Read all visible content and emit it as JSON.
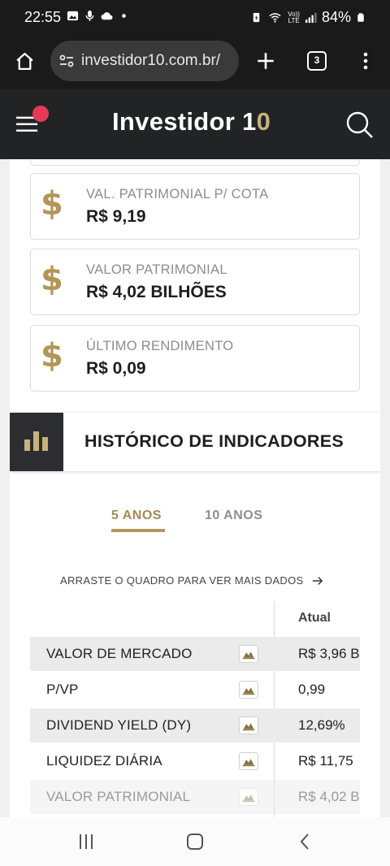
{
  "status_bar": {
    "time": "22:55",
    "battery": "84%",
    "volte_top": "Vo))",
    "volte_bottom": "LTE"
  },
  "browser": {
    "url": "investidor10.com.br/",
    "tab_count": "3"
  },
  "site_header": {
    "logo_main": "Investidor 1",
    "logo_accent": "0"
  },
  "cards": [
    {
      "label": "VAL. PATRIMONIAL P/ COTA",
      "value": "R$ 9,19",
      "icon": "$"
    },
    {
      "label": "VALOR PATRIMONIAL",
      "value": "R$ 4,02 BILHÕES",
      "icon": "$"
    },
    {
      "label": "ÚLTIMO RENDIMENTO",
      "value": "R$ 0,09",
      "icon": "$"
    }
  ],
  "section": {
    "title": "HISTÓRICO DE INDICADORES"
  },
  "tabs": {
    "active": "5 ANOS",
    "inactive": "10 ANOS"
  },
  "drag_hint": "ARRASTE O QUADRO PARA VER MAIS DADOS",
  "table": {
    "column_header": "Atual",
    "rows": [
      {
        "label": "VALOR DE MERCADO",
        "value": "R$ 3,96 B"
      },
      {
        "label": "P/VP",
        "value": "0,99"
      },
      {
        "label": "DIVIDEND YIELD (DY)",
        "value": "12,69%"
      },
      {
        "label": "LIQUIDEZ DIÁRIA",
        "value": "R$ 11,75"
      },
      {
        "label": "VALOR PATRIMONIAL",
        "value": "R$ 4,02 B"
      }
    ]
  },
  "colors": {
    "gold": "#b09657",
    "dark_header": "#222325",
    "notification": "#e63956"
  }
}
